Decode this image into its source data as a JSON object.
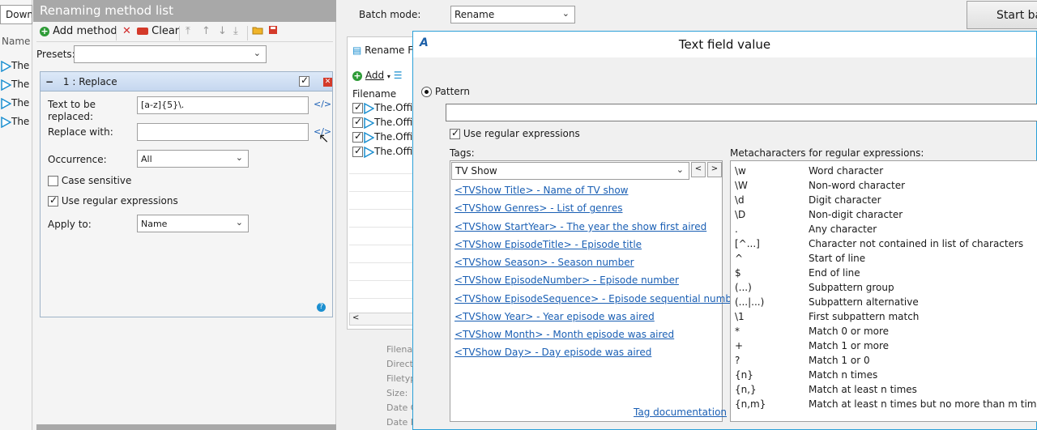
{
  "left_strip": {
    "combo_text": "Down",
    "column_header": "Name",
    "rows": [
      "The",
      "The",
      "The",
      "The"
    ]
  },
  "renaming_panel": {
    "title": "Renaming method list",
    "toolbar": {
      "add_method": "Add method",
      "clear": "Clear"
    },
    "presets_label": "Presets:",
    "presets_value": "",
    "method": {
      "header": "1 : Replace",
      "text_to_be_replaced_label": "Text to be replaced:",
      "text_to_be_replaced_value": "[a-z]{5}\\.",
      "replace_with_label": "Replace with:",
      "replace_with_value": "",
      "occurrence_label": "Occurrence:",
      "occurrence_value": "All",
      "case_sensitive_label": "Case sensitive",
      "use_regex_label": "Use regular expressions",
      "apply_to_label": "Apply to:",
      "apply_to_value": "Name"
    }
  },
  "batch": {
    "label": "Batch mode:",
    "value": "Rename",
    "start_button": "Start ba"
  },
  "files_panel": {
    "tab": "Rename Fi",
    "add_label": "Add",
    "column_header": "Filename",
    "rows": [
      "The.Offi",
      "The.Offi",
      "The.Offi",
      "The.Offi"
    ],
    "properties": [
      "Filenar",
      "Direct",
      "Filetyp",
      "Size:",
      "Date C",
      "Date M"
    ]
  },
  "dialog": {
    "title": "Text field value",
    "pattern_label": "Pattern",
    "pattern_value": "",
    "use_regex_label": "Use regular expressions",
    "tags_label": "Tags:",
    "tags_select": "TV Show",
    "tags": [
      "<TVShow Title> - Name of TV show",
      "<TVShow Genres> - List of genres",
      "<TVShow StartYear> - The year the show first aired",
      "<TVShow EpisodeTitle> - Episode title",
      "<TVShow Season> - Season number",
      "<TVShow EpisodeNumber> - Episode number",
      "<TVShow EpisodeSequence> - Episode sequential number",
      "<TVShow Year> - Year episode was aired",
      "<TVShow Month> - Month episode was aired",
      "<TVShow Day> - Day episode was aired"
    ],
    "tag_documentation": "Tag documentation",
    "meta_label": "Metacharacters for regular expressions:",
    "metacharacters": [
      {
        "k": "\\w",
        "d": "Word character"
      },
      {
        "k": "\\W",
        "d": "Non-word character"
      },
      {
        "k": "\\d",
        "d": "Digit character"
      },
      {
        "k": "\\D",
        "d": "Non-digit character"
      },
      {
        "k": ".",
        "d": "Any character"
      },
      {
        "k": "[^...]",
        "d": "Character not contained in list of characters"
      },
      {
        "k": "^",
        "d": "Start of line"
      },
      {
        "k": "$",
        "d": "End of line"
      },
      {
        "k": "(...)",
        "d": "Subpattern group"
      },
      {
        "k": "(...|...)",
        "d": "Subpattern alternative"
      },
      {
        "k": "\\1",
        "d": "First subpattern match"
      },
      {
        "k": "*",
        "d": "Match 0 or more"
      },
      {
        "k": "+",
        "d": "Match 1 or more"
      },
      {
        "k": "?",
        "d": "Match 1 or 0"
      },
      {
        "k": "{n}",
        "d": "Match n times"
      },
      {
        "k": "{n,}",
        "d": "Match at least n times"
      },
      {
        "k": "{n,m}",
        "d": "Match at least n times but no more than m times"
      }
    ]
  }
}
